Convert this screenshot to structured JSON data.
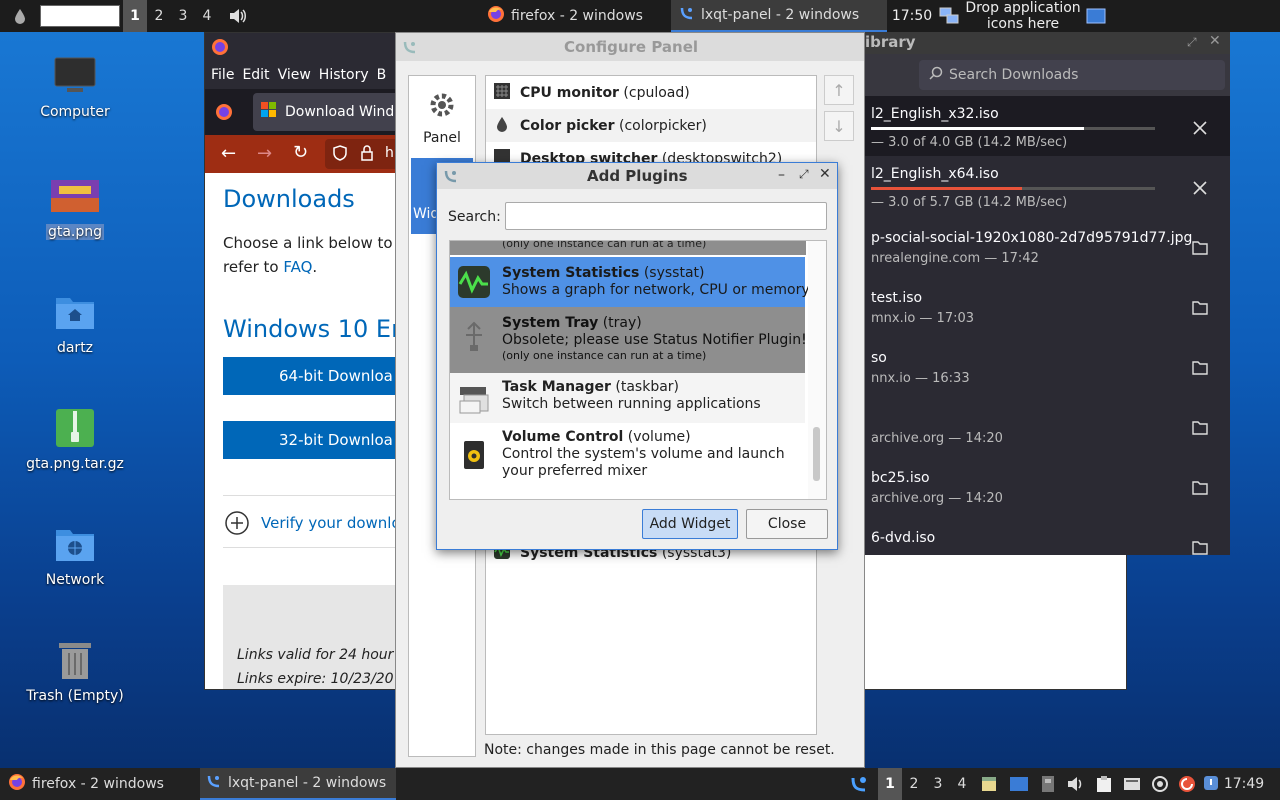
{
  "top_panel": {
    "workspaces": [
      "1",
      "2",
      "3",
      "4"
    ],
    "tasks": [
      {
        "label": "firefox - 2 windows"
      },
      {
        "label": "lxqt-panel - 2 windows"
      }
    ],
    "clock": "17:50",
    "quicklaunch_hint": [
      "Drop application",
      "icons here"
    ]
  },
  "desktop_icons": [
    {
      "label": "Computer"
    },
    {
      "label": "gta.png"
    },
    {
      "label": "dartz"
    },
    {
      "label": "gta.png.tar.gz"
    },
    {
      "label": "Network"
    },
    {
      "label": "Trash (Empty)"
    }
  ],
  "firefox": {
    "menu": [
      "File",
      "Edit",
      "View",
      "History",
      "B"
    ],
    "tab_title": "Download Windo",
    "url_fragment": "h",
    "heading": "Downloads",
    "intro_line1": "Choose a link below to b",
    "intro_line2_prefix": "refer to ",
    "intro_link": "FAQ",
    "intro_suffix": ".",
    "section_heading": "Windows 10 Eng",
    "btn64": "64-bit Downloa",
    "btn32": "32-bit Downloa",
    "verify": "Verify your downlo",
    "valid_note": "Links valid for 24 hour",
    "expire_note": "Links expire: 10/23/20"
  },
  "downloads": {
    "title": "ibrary",
    "search_placeholder": "Search Downloads",
    "items": [
      {
        "name": "l2_English_x32.iso",
        "status": "— 3.0 of 4.0 GB (14.2 MB/sec)",
        "progress": 0.75
      },
      {
        "name": "l2_English_x64.iso",
        "status": "— 3.0 of 5.7 GB (14.2 MB/sec)",
        "progress": 0.53
      },
      {
        "name": "p-social-social-1920x1080-2d7d95791d77.jpg",
        "status": "nrealengine.com — 17:42"
      },
      {
        "name": "test.iso",
        "status": "mnx.io — 17:03"
      },
      {
        "name": "so",
        "status": "nnx.io — 16:33"
      },
      {
        "name": "",
        "status": "archive.org — 14:20"
      },
      {
        "name": "bc25.iso",
        "status": "archive.org — 14:20"
      },
      {
        "name": "6-dvd.iso",
        "status": ""
      }
    ]
  },
  "configure_panel": {
    "title": "Configure Panel",
    "sidebar": [
      {
        "label": "Panel"
      },
      {
        "label": "Wid"
      }
    ],
    "plugins": [
      {
        "bold": "CPU monitor",
        "rest": " (cpuload)"
      },
      {
        "bold": "Color picker",
        "rest": " (colorpicker)"
      },
      {
        "bold": "Desktop switcher",
        "rest": " (desktopswitch2)"
      }
    ],
    "bottom_plugin": {
      "bold": "System Statistics",
      "rest": " (sysstat3)"
    },
    "note": "Note: changes made in this page cannot be reset."
  },
  "add_plugins": {
    "title": "Add Plugins",
    "search_label": "Search:",
    "search_value": "",
    "clipped_top": "(only one instance can run at a time)",
    "items": [
      {
        "bold": "System Statistics",
        "rest": " (sysstat)",
        "desc": "Shows a graph for network, CPU or memory",
        "note": ""
      },
      {
        "bold": "System Tray",
        "rest": " (tray)",
        "desc": "Obsolete; please use Status Notifier Plugin!",
        "note": "(only one instance can run at a time)"
      },
      {
        "bold": "Task Manager",
        "rest": " (taskbar)",
        "desc": "Switch between running applications",
        "note": ""
      },
      {
        "bold": "Volume Control",
        "rest": " (volume)",
        "desc": "Control the system's volume and launch",
        "desc2": "your preferred mixer",
        "note": ""
      }
    ],
    "add_button": "Add Widget",
    "close_button": "Close"
  },
  "bottom_panel": {
    "tasks": [
      {
        "label": "firefox - 2 windows"
      },
      {
        "label": "lxqt-panel - 2 windows"
      }
    ],
    "workspaces": [
      "1",
      "2",
      "3",
      "4"
    ],
    "clock": "17:49"
  },
  "colors": {
    "accent": "#3a7cd6",
    "panel_bg": "#1c1c1c",
    "ms_blue": "#0067b8",
    "selection": "#4f91e6"
  }
}
